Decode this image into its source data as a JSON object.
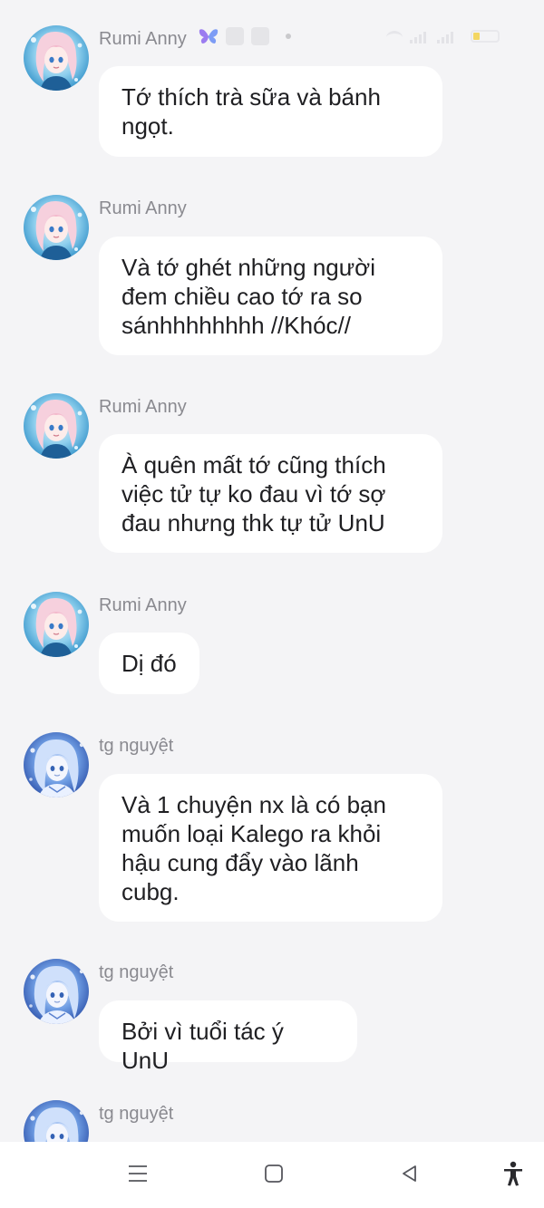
{
  "messages": [
    {
      "sender": "Rumi Anny",
      "text": "Tớ thích trà sữa và bánh\nngọt.",
      "avatar": "pink-hair-anime-girl-avatar"
    },
    {
      "sender": "Rumi Anny",
      "text": "Và tớ ghét những người\nđem chiều cao tớ ra so\nsánhhhhhhhh //Khóc//",
      "avatar": "pink-hair-anime-girl-avatar"
    },
    {
      "sender": "Rumi Anny",
      "text": "À quên mất tớ cũng thích\nviệc tử tự ko đau vì tớ sợ\nđau nhưng thk tự tử UnU",
      "avatar": "pink-hair-anime-girl-avatar"
    },
    {
      "sender": "Rumi Anny",
      "text": "Dị đó",
      "avatar": "pink-hair-anime-girl-avatar"
    },
    {
      "sender": "tg nguyệt",
      "text": "Và 1 chuyện nx là có bạn\nmuốn loại Kalego ra khỏi\nhậu cung đẩy vào lãnh\ncubg.",
      "avatar": "blue-hair-anime-girl-avatar"
    },
    {
      "sender": "tg nguyệt",
      "text": "Bởi vì tuổi tác ý UnU",
      "avatar": "blue-hair-anime-girl-avatar"
    },
    {
      "sender": "tg nguyệt",
      "text": "",
      "avatar": "blue-hair-anime-girl-avatar"
    }
  ],
  "status_bar": {
    "butterfly_icon": "butterfly-icon",
    "battery_level": 0.25,
    "battery_color": "#f3d663"
  },
  "nav_bar": {
    "menu_icon": "menu-icon",
    "home_icon": "home-square-icon",
    "back_icon": "back-triangle-icon",
    "accessibility_icon": "accessibility-icon"
  },
  "colors": {
    "background": "#f4f4f6",
    "bubble": "#ffffff",
    "sender_text": "#8a8a90",
    "message_text": "#1f1f22"
  }
}
